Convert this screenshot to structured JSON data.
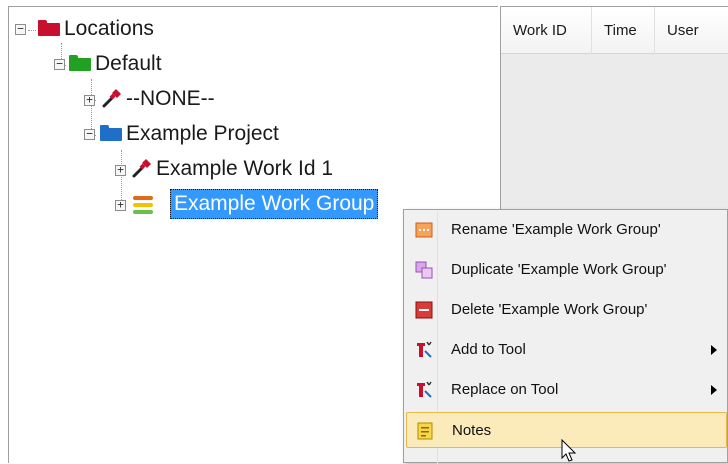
{
  "tree": {
    "root": {
      "label": "Locations",
      "expander": "−"
    },
    "default": {
      "label": "Default",
      "expander": "−"
    },
    "none": {
      "label": "--NONE--",
      "expander": "+"
    },
    "project": {
      "label": "Example Project",
      "expander": "−"
    },
    "work_id": {
      "label": "Example Work Id 1",
      "expander": "+"
    },
    "work_group": {
      "label": "Example Work Group",
      "expander": "+",
      "selected": true
    }
  },
  "grid": {
    "columns": [
      "Work ID",
      "Time",
      "User"
    ]
  },
  "context_menu": {
    "items": [
      {
        "label": "Rename 'Example Work Group'",
        "icon": "rename-icon"
      },
      {
        "label": "Duplicate 'Example Work Group'",
        "icon": "duplicate-icon"
      },
      {
        "label": "Delete 'Example Work Group'",
        "icon": "delete-icon"
      },
      {
        "label": "Add to Tool",
        "icon": "add-to-tool-icon",
        "submenu": true
      },
      {
        "label": "Replace on Tool",
        "icon": "replace-on-tool-icon",
        "submenu": true
      },
      {
        "label": "Notes",
        "icon": "notes-icon",
        "hover": true
      }
    ]
  },
  "colors": {
    "root_folder": "#c8102e",
    "default_folder": "#22a022",
    "project_folder": "#1f6fc8",
    "selection": "#3399ff",
    "menu_hover": "#fbeaba"
  }
}
